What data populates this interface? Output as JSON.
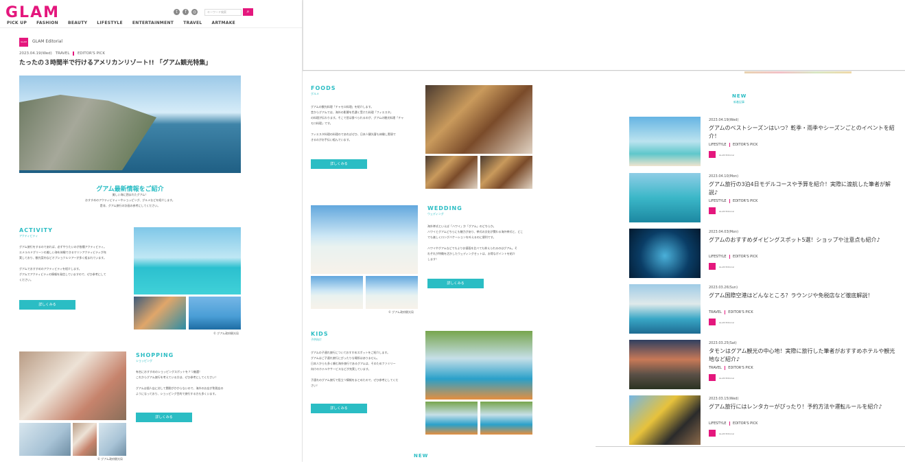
{
  "header": {
    "logo": "GLAM",
    "nav": [
      "PICK UP",
      "FASHION",
      "BEAUTY",
      "LIFESTYLE",
      "ENTERTAINMENT",
      "TRAVEL",
      "ARTMAKE"
    ],
    "search_placeholder": "キーワード検索"
  },
  "article": {
    "author": "GLAM Editorial",
    "author_avatar": "GLAM",
    "date": "2023.04.19(Wed)",
    "category": "TRAVEL",
    "tag": "EDITOR'S PICK",
    "title": "たったの３時間半で行けるアメリカンリゾート!! 「グアム観光特集」"
  },
  "intro": {
    "title": "グアム最新情報をご紹介",
    "lines": [
      "美しい海に囲まれたグアム！",
      "おすすめのアクティビティーやショッピング、グルメなどを紹介します。",
      "是非、グアム旅行の計画の参考にしてください。"
    ]
  },
  "activity": {
    "title": "ACTIVITY",
    "sub": "アクティビティ",
    "text": [
      "グアム旅行をするのであれば、必ずやりたいのが各種アクティビティ。",
      "エメラルドグリーンの美しい海を体験できるマリンアクティビティが充",
      "実しており、観光案内などオプショナルツアーが多く組まれています。",
      "",
      "グアムでおすすめのアクティビティを紹介します。",
      "グアムでアクティビティの情報を発信していますので、ぜひ参考にして",
      "ください。"
    ],
    "button": "詳しくみる",
    "caption": "© グアム政府観光局"
  },
  "shopping": {
    "title": "SHOPPING",
    "sub": "ショッピング",
    "text": [
      "有名におすすめのショッピングスポットを７つ厳選！",
      "これからグアム旅行を考えている方は、ぜひ参考にしてください！",
      "",
      "グアムは個人店に対して関税がかからないので、海外のお店が免税店の",
      "ようになっており、ショッピング目的で旅行する方も多くいます。"
    ],
    "button": "詳しくみる",
    "caption": "© グアム政府観光局"
  },
  "foods": {
    "title": "FOODS",
    "sub": "グルメ",
    "text": [
      "グアムの観光料理「チャモロ料理」を紹介します。",
      "昔からグアムでは、海外の影響を色濃く受けた料理「フィエスタ」",
      "の料理が伝わります。そこで昔は食べられるのが、グアムの観光料理「チャ",
      "モロ料理」です。",
      "",
      "フィエスタ料理の料理のであればぜひ、日本人観光客も体験し実現で",
      "きるのがお手伝い組んでいます。"
    ],
    "button": "詳しくみる"
  },
  "wedding": {
    "title": "WEDDING",
    "sub": "ウェディング",
    "text": [
      "海外挙式といえば「ハワイ」か「グアム」のどちらか。",
      "ハワイとグアムどちらにも魅力があり、挙式の文化が関わる海外挙式と、どこ",
      "でも楽しくロングバケーションを叶えるのに便利です。",
      "",
      "ハワイやグアムなどでもよりお値段を比べても抑えられるのはグアム。そ",
      "れぞれが特徴を活かしたウェディングセットは、お得なポイントを紹介",
      "します！"
    ],
    "button": "詳しくみる",
    "caption": "© グアム政府観光局"
  },
  "kids": {
    "title": "KIDS",
    "sub": "子供向け",
    "text": [
      "グアムの子連れ旅行についておすすめスポットをご紹介します。",
      "グアムはご子連れ旅行にぴったりな場所はありません。",
      "日本人からも多く頼む海外旅行であるグアムは、そのためファミリー",
      "向けのホテルやサービスなどが充実しています。",
      "",
      "子連れのグアム旅行で役立つ情報をまとめたので、ぜひ参考にしてくだ",
      "さい！"
    ],
    "button": "詳しくみる"
  },
  "new_list": {
    "title": "NEW",
    "sub": "新着記事",
    "bottom_title": "NEW",
    "items": [
      {
        "date": "2023.04.19(Wed)",
        "title": "グアムのベストシーズンはいつ？乾季・雨季やシーズンごとのイベントを紹介！",
        "category": "LIFESTYLE",
        "tag": "EDITOR'S PICK",
        "author": "GLAM Editorial"
      },
      {
        "date": "2023.04.10(Mon)",
        "title": "グアム旅行の3泊4日モデルコースや予算を紹介！実際に渡航した筆者が解説♪",
        "category": "LIFESTYLE",
        "tag": "EDITOR'S PICK",
        "author": "GLAM Editorial"
      },
      {
        "date": "2023.04.03(Mon)",
        "title": "グアムのおすすめダイビングスポット5選！ショップや注意点も紹介♪",
        "category": "LIFESTYLE",
        "tag": "EDITOR'S PICK",
        "author": "GLAM Editorial"
      },
      {
        "date": "2023.03.26(Sun)",
        "title": "グアム国際空港はどんなところ？ラウンジや免税店など徹底解説！",
        "category": "TRAVEL",
        "tag": "EDITOR'S PICK",
        "author": "GLAM Editorial"
      },
      {
        "date": "2023.03.25(Sat)",
        "title": "タモンはグアム観光の中心地！実際に旅行した筆者がおすすめホテルや観光地など紹介♪",
        "category": "TRAVEL",
        "tag": "EDITOR'S PICK",
        "author": "GLAM Editorial"
      },
      {
        "date": "2023.03.15(Wed)",
        "title": "グアム旅行にはレンタカーがぴったり！予約方法や運転ルールを紹介♪",
        "category": "LIFESTYLE",
        "tag": "EDITOR'S PICK",
        "author": "GLAM Editorial"
      }
    ]
  },
  "colors": {
    "brand_pink": "#e4177d",
    "accent_teal": "#2bbdc4"
  },
  "icons": [
    "twitter-icon",
    "facebook-icon",
    "instagram-icon",
    "search-icon"
  ]
}
